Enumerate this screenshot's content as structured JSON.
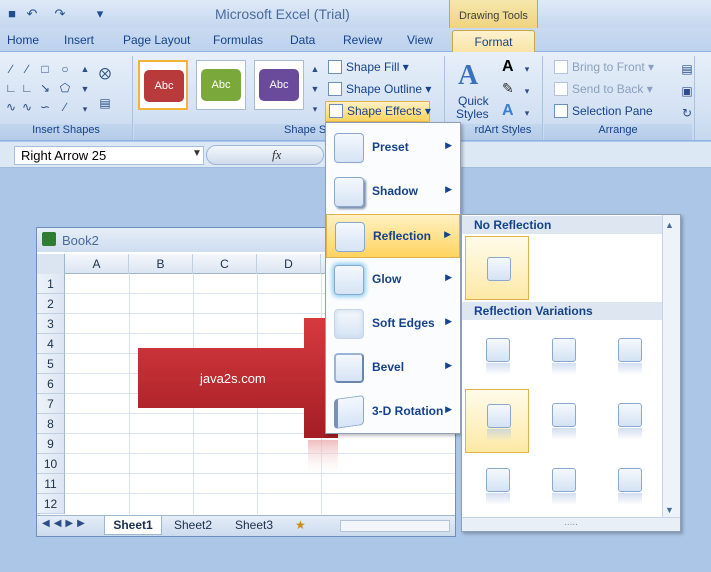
{
  "app": {
    "title": "Microsoft Excel (Trial)",
    "context_tab_group": "Drawing Tools"
  },
  "tabs": [
    {
      "label": "Home"
    },
    {
      "label": "Insert"
    },
    {
      "label": "Page Layout"
    },
    {
      "label": "Formulas"
    },
    {
      "label": "Data"
    },
    {
      "label": "Review"
    },
    {
      "label": "View"
    },
    {
      "label": "Format"
    }
  ],
  "ribbon": {
    "groups": {
      "insert_shapes": "Insert Shapes",
      "shape_styles": "Shape Styles",
      "wordart_styles": "rdArt Styles",
      "arrange": "Arrange"
    },
    "style_thumbs": [
      {
        "label": "Abc",
        "color": "#b93a3a"
      },
      {
        "label": "Abc",
        "color": "#7aa83b"
      },
      {
        "label": "Abc",
        "color": "#6a4a9a"
      }
    ],
    "shape_fill": "Shape Fill",
    "shape_outline": "Shape Outline",
    "shape_effects": "Shape Effects",
    "quick_styles_1": "Quick",
    "quick_styles_2": "Styles",
    "bring_to_front": "Bring to Front",
    "send_to_back": "Send to Back",
    "selection_pane": "Selection Pane"
  },
  "formula_bar": {
    "name_box": "Right Arrow 25",
    "fx": "fx"
  },
  "workbook": {
    "title": "Book2",
    "columns": [
      "A",
      "B",
      "C",
      "D"
    ],
    "rows": [
      "1",
      "2",
      "3",
      "4",
      "5",
      "6",
      "7",
      "8",
      "9",
      "10",
      "11",
      "12"
    ],
    "sheets": [
      "Sheet1",
      "Sheet2",
      "Sheet3"
    ],
    "arrow_text": "java2s.com"
  },
  "effects_menu": {
    "items": [
      {
        "label": "Preset"
      },
      {
        "label": "Shadow"
      },
      {
        "label": "Reflection"
      },
      {
        "label": "Glow"
      },
      {
        "label": "Soft Edges"
      },
      {
        "label": "Bevel"
      },
      {
        "label": "3-D Rotation"
      }
    ]
  },
  "reflection_gallery": {
    "no_reflection": "No Reflection",
    "variations": "Reflection Variations",
    "footer": "....."
  },
  "colors": {
    "accent": "#15428b",
    "arrow": "#c0282d",
    "highlight": "#ffd35e"
  }
}
